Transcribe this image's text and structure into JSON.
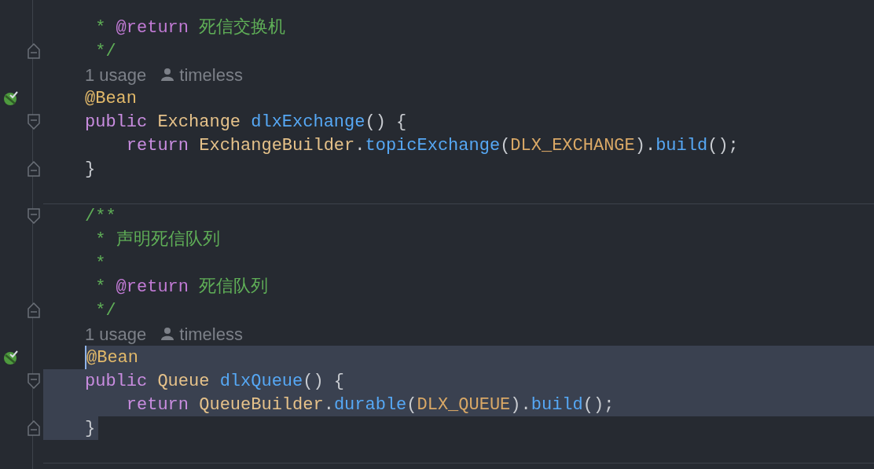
{
  "lines": [
    {
      "kind": "code",
      "bean": false,
      "fold_start": false,
      "fold_end": false,
      "tokens": [
        {
          "kind": "comment",
          "text": " * "
        },
        {
          "kind": "doctag",
          "text": "@return"
        },
        {
          "kind": "comment",
          "text": " 死信交换机"
        }
      ]
    },
    {
      "kind": "code",
      "bean": false,
      "fold_start": false,
      "fold_end": true,
      "tokens": [
        {
          "kind": "comment",
          "text": " */"
        }
      ]
    },
    {
      "kind": "hint",
      "usage": "1 usage",
      "author": "timeless"
    },
    {
      "kind": "code",
      "bean": true,
      "fold_start": false,
      "fold_end": false,
      "tokens": [
        {
          "kind": "annotation",
          "text": "@Bean"
        }
      ]
    },
    {
      "kind": "code",
      "bean": false,
      "fold_start": true,
      "fold_end": false,
      "tokens": [
        {
          "kind": "keyword",
          "text": "public "
        },
        {
          "kind": "type",
          "text": "Exchange "
        },
        {
          "kind": "method",
          "text": "dlxExchange"
        },
        {
          "kind": "plain",
          "text": "() {"
        }
      ]
    },
    {
      "kind": "code",
      "bean": false,
      "fold_start": false,
      "fold_end": false,
      "tokens": [
        {
          "kind": "keyword",
          "text": "    return "
        },
        {
          "kind": "type",
          "text": "ExchangeBuilder"
        },
        {
          "kind": "plain",
          "text": "."
        },
        {
          "kind": "method",
          "text": "topicExchange"
        },
        {
          "kind": "plain",
          "text": "("
        },
        {
          "kind": "constant",
          "text": "DLX_EXCHANGE"
        },
        {
          "kind": "plain",
          "text": ")."
        },
        {
          "kind": "method",
          "text": "build"
        },
        {
          "kind": "plain",
          "text": "();"
        }
      ]
    },
    {
      "kind": "code",
      "bean": false,
      "fold_start": false,
      "fold_end": true,
      "tokens": [
        {
          "kind": "plain",
          "text": "}"
        }
      ]
    },
    {
      "kind": "blank",
      "separator": true
    },
    {
      "kind": "code",
      "bean": false,
      "fold_start": true,
      "fold_end": false,
      "tokens": [
        {
          "kind": "comment",
          "text": "/**"
        }
      ]
    },
    {
      "kind": "code",
      "bean": false,
      "fold_start": false,
      "fold_end": false,
      "tokens": [
        {
          "kind": "comment",
          "text": " * 声明死信队列"
        }
      ]
    },
    {
      "kind": "code",
      "bean": false,
      "fold_start": false,
      "fold_end": false,
      "tokens": [
        {
          "kind": "comment",
          "text": " *"
        }
      ]
    },
    {
      "kind": "code",
      "bean": false,
      "fold_start": false,
      "fold_end": false,
      "tokens": [
        {
          "kind": "comment",
          "text": " * "
        },
        {
          "kind": "doctag",
          "text": "@return"
        },
        {
          "kind": "comment",
          "text": " 死信队列"
        }
      ]
    },
    {
      "kind": "code",
      "bean": false,
      "fold_start": false,
      "fold_end": true,
      "tokens": [
        {
          "kind": "comment",
          "text": " */"
        }
      ]
    },
    {
      "kind": "hint",
      "usage": "1 usage",
      "author": "timeless"
    },
    {
      "kind": "caret",
      "bean": true,
      "fold_start": false,
      "fold_end": false,
      "tokens": [
        {
          "kind": "annotation",
          "text": "@Bean"
        }
      ]
    },
    {
      "kind": "selected",
      "bean": false,
      "fold_start": true,
      "fold_end": false,
      "tokens": [
        {
          "kind": "keyword",
          "text": "public "
        },
        {
          "kind": "type",
          "text": "Queue "
        },
        {
          "kind": "method",
          "text": "dlxQueue"
        },
        {
          "kind": "plain",
          "text": "() {"
        }
      ]
    },
    {
      "kind": "selected",
      "bean": false,
      "fold_start": false,
      "fold_end": false,
      "tokens": [
        {
          "kind": "keyword",
          "text": "    return "
        },
        {
          "kind": "type",
          "text": "QueueBuilder"
        },
        {
          "kind": "plain",
          "text": "."
        },
        {
          "kind": "method",
          "text": "durable"
        },
        {
          "kind": "plain",
          "text": "("
        },
        {
          "kind": "constant",
          "text": "DLX_QUEUE"
        },
        {
          "kind": "plain",
          "text": ")."
        },
        {
          "kind": "method",
          "text": "build"
        },
        {
          "kind": "plain",
          "text": "();"
        }
      ]
    },
    {
      "kind": "tail",
      "bean": false,
      "fold_start": false,
      "fold_end": true,
      "tokens": [
        {
          "kind": "plain",
          "text": "}"
        }
      ]
    },
    {
      "kind": "blank",
      "separator": true
    }
  ]
}
